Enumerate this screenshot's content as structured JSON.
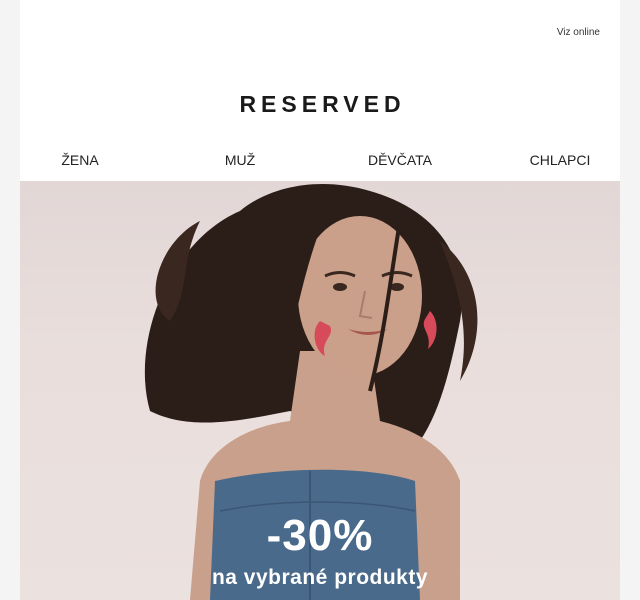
{
  "header": {
    "view_online": "Viz online",
    "logo_text": "RESERVED"
  },
  "nav": {
    "items": [
      {
        "label": "ŽENA"
      },
      {
        "label": "MUŽ"
      },
      {
        "label": "DĚVČATA"
      },
      {
        "label": "CHLAPCI"
      }
    ]
  },
  "hero": {
    "discount": "-30%",
    "subtitle": "na vybrané produkty"
  },
  "colors": {
    "background": "#f4f4f4",
    "hero_bg": "#e6dcda",
    "text": "#222222",
    "denim": "#4a6a8c",
    "earring": "#d64a5a",
    "hair": "#2b1d17",
    "skin": "#caa08a"
  }
}
